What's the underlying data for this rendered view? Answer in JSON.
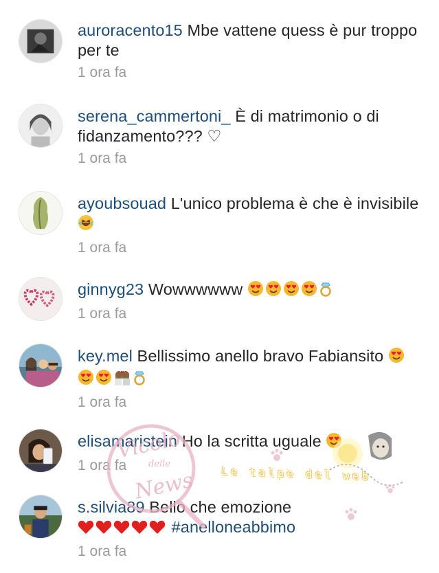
{
  "comments": [
    {
      "username": "auroracento15",
      "text_before": " Mbe vattene quess è pur troppo per te",
      "emojis": [],
      "text_after": "",
      "time": "1 ora fa",
      "avatar": "avatar-photo-dark"
    },
    {
      "username": "serena_cammertoni_",
      "text_before": " È di matrimonio o di fidanzamento??? ♡",
      "emojis": [],
      "text_after": "",
      "time": "1 ora fa",
      "avatar": "avatar-photo-girl"
    },
    {
      "username": "ayoubsouad",
      "text_before": " L'unico problema è che è invisibile ",
      "emojis": [
        "laughing"
      ],
      "text_after": "",
      "time": "1 ora fa",
      "avatar": "avatar-tree"
    },
    {
      "username": "ginnyg23",
      "text_before": " Wowwwwww ",
      "emojis": [
        "heart-eyes",
        "heart-eyes",
        "heart-eyes",
        "heart-eyes",
        "ring"
      ],
      "text_after": "",
      "time": "1 ora fa",
      "avatar": "avatar-hearts"
    },
    {
      "username": "key.mel",
      "text_before": " Bellissimo anello bravo Fabiansito ",
      "emojis": [
        "heart-eyes",
        "heart-eyes",
        "heart-eyes",
        "couple",
        "ring"
      ],
      "text_after": "",
      "time": "1 ora fa",
      "avatar": "avatar-group-photo"
    },
    {
      "username": "elisamaristein",
      "text_before": " Ho la scritta uguale ",
      "emojis": [
        "heart-eyes"
      ],
      "text_after": "",
      "time": "1 ora fa",
      "avatar": "avatar-phone-selfie"
    },
    {
      "username": "s.silvia89",
      "text_before": " Bello che emozione ",
      "emojis": [
        "red-heart",
        "red-heart",
        "red-heart",
        "red-heart",
        "red-heart"
      ],
      "text_after": " #anelloneabbimo",
      "time": "1 ora fa",
      "avatar": "avatar-outdoor"
    }
  ],
  "watermark": {
    "stamp_line1": "Vicolo",
    "stamp_line2": "delle",
    "stamp_line3": "News",
    "banner": "Le talpe del web"
  }
}
